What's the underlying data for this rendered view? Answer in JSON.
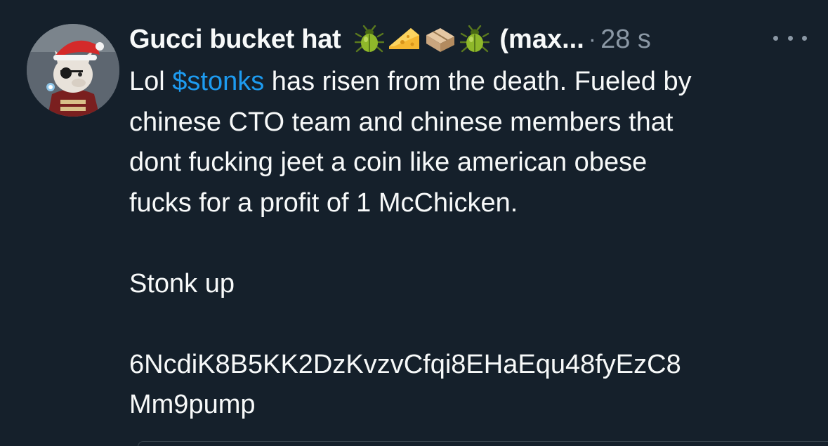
{
  "author": {
    "display_name": "Gucci bucket hat",
    "name_emojis": [
      "beetle-emoji",
      "cheese-emoji",
      "parcel-emoji",
      "beetle-emoji"
    ],
    "handle": "(max...",
    "separator": "·",
    "timestamp": "28 s"
  },
  "tweet": {
    "line1_prefix": "Lol ",
    "cashtag": "$stonks",
    "line1_suffix": " has risen from the death. Fueled by",
    "line2": "chinese CTO team and chinese members that",
    "line3": "dont fucking jeet a coin like american obese",
    "line4": "fucks for a profit of 1 McChicken.",
    "line5": "Stonk up",
    "line6": "6NcdiK8B5KK2DzKvzvCfqi8EHaEqu48fyEzC8",
    "line7": "Mm9pump"
  },
  "colors": {
    "background": "#15202b",
    "text": "#f7f9f9",
    "muted": "#8b98a5",
    "link": "#1d9bf0"
  }
}
